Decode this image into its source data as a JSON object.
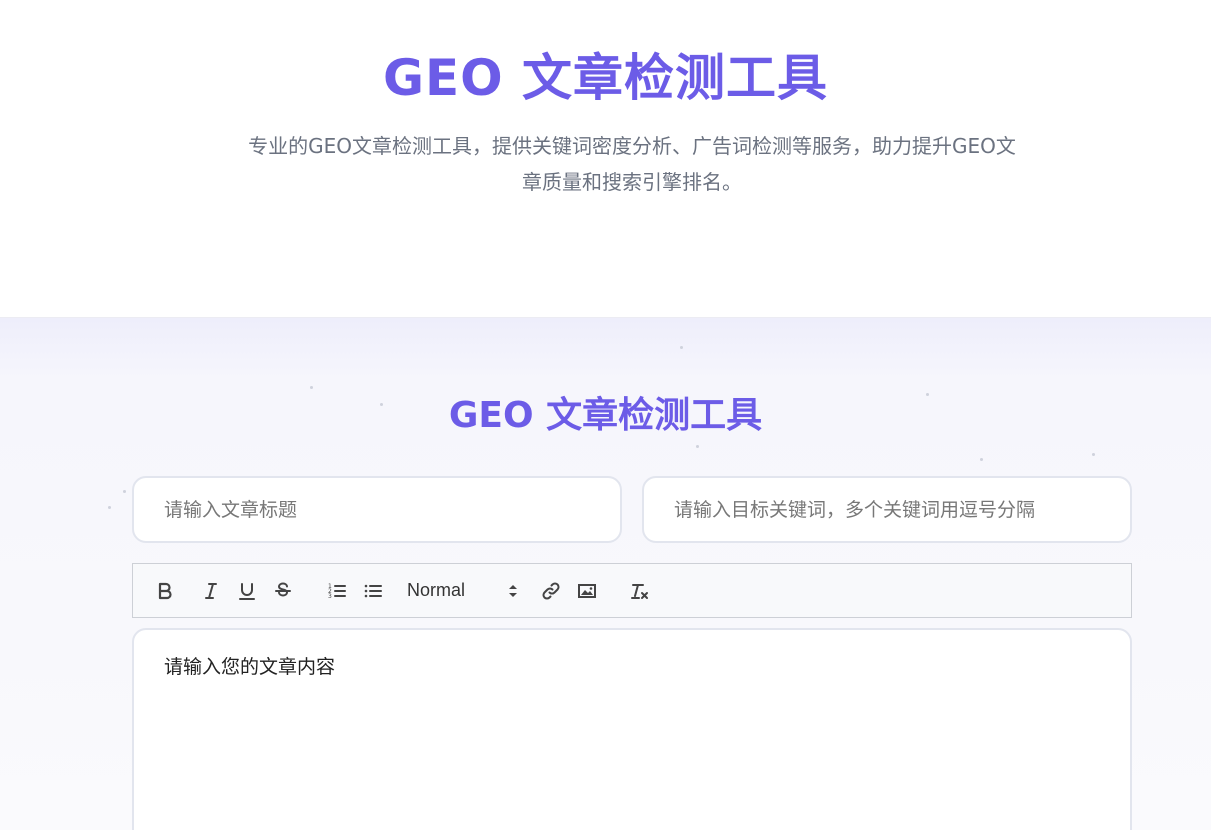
{
  "hero": {
    "title": "GEO 文章检测工具",
    "description": "专业的GEO文章检测工具，提供关键词密度分析、广告词检测等服务，助力提升GEO文章质量和搜索引擎排名。"
  },
  "tool": {
    "title": "GEO 文章检测工具",
    "title_input": {
      "placeholder": "请输入文章标题",
      "value": ""
    },
    "keywords_input": {
      "placeholder": "请输入目标关键词，多个关键词用逗号分隔",
      "value": ""
    },
    "toolbar": {
      "icons": [
        "bold-icon",
        "italic-icon",
        "underline-icon",
        "strikethrough-icon",
        "ordered-list-icon",
        "bullet-list-icon",
        "link-icon",
        "image-icon",
        "clear-format-icon"
      ],
      "heading_select": "Normal"
    },
    "editor": {
      "placeholder": "请输入您的文章内容"
    }
  },
  "colors": {
    "accent": "#6c5ce7",
    "muted_text": "#6b7280",
    "border": "#e2e5ee"
  }
}
